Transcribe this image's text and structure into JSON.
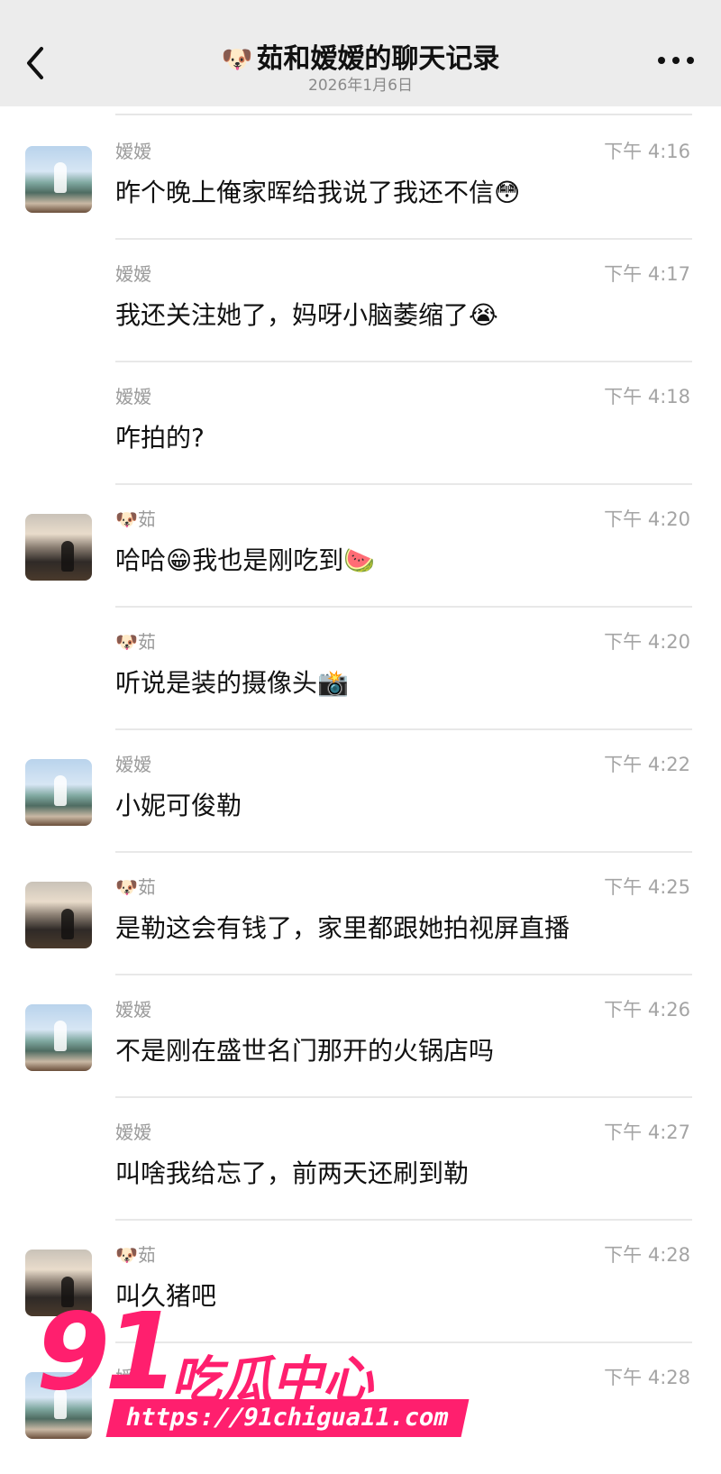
{
  "header": {
    "title_emoji": "🐶",
    "title": "茹和嫒嫒的聊天记录",
    "subtitle": "2026年1月6日",
    "back_icon": "chevron-left-icon",
    "more_icon": "more-dots-icon"
  },
  "messages": [
    {
      "sender": "嫒嫒",
      "time": "下午 4:16",
      "text": "昨个晚上俺家晖给我说了我还不信😳",
      "avatar": "yuan"
    },
    {
      "sender": "嫒嫒",
      "time": "下午 4:17",
      "text": "我还关注她了，妈呀小脑萎缩了😭",
      "avatar": ""
    },
    {
      "sender": "嫒嫒",
      "time": "下午 4:18",
      "text": "咋拍的?",
      "avatar": ""
    },
    {
      "sender": "🐶茹",
      "time": "下午 4:20",
      "text": "哈哈😁我也是刚吃到🍉",
      "avatar": "ru"
    },
    {
      "sender": "🐶茹",
      "time": "下午 4:20",
      "text": "听说是装的摄像头📸",
      "avatar": ""
    },
    {
      "sender": "嫒嫒",
      "time": "下午 4:22",
      "text": "小妮可俊勒",
      "avatar": "yuan"
    },
    {
      "sender": "🐶茹",
      "time": "下午 4:25",
      "text": "是勒这会有钱了，家里都跟她拍视屏直播",
      "avatar": "ru"
    },
    {
      "sender": "嫒嫒",
      "time": "下午 4:26",
      "text": "不是刚在盛世名门那开的火锅店吗",
      "avatar": "yuan"
    },
    {
      "sender": "嫒嫒",
      "time": "下午 4:27",
      "text": "叫啥我给忘了，前两天还刷到勒",
      "avatar": ""
    },
    {
      "sender": "🐶茹",
      "time": "下午 4:28",
      "text": "叫久猪吧",
      "avatar": "ru"
    },
    {
      "sender": "嫒",
      "time": "下午 4:28",
      "text": "",
      "avatar": "yuan"
    }
  ],
  "watermark": {
    "number": "91",
    "name": "吃瓜中心",
    "url": "https://91chigua11.com"
  },
  "colors": {
    "header_bg": "#ececec",
    "watermark": "#ff1f6e",
    "time_text": "#a4a4a4"
  }
}
